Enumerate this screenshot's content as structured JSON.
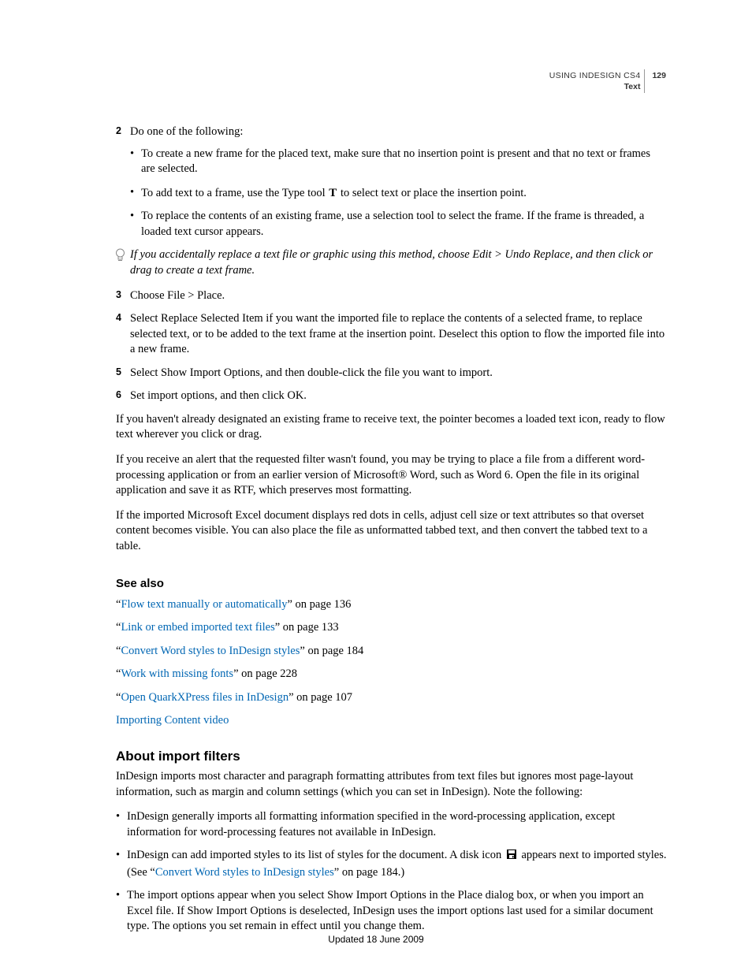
{
  "header": {
    "product": "USING INDESIGN CS4",
    "page_number": "129",
    "section": "Text"
  },
  "steps": {
    "s2": {
      "num": "2",
      "text": "Do one of the following:"
    },
    "s2_bullets": {
      "b1": "To create a new frame for the placed text, make sure that no insertion point is present and that no text or frames are selected.",
      "b2_a": "To add text to a frame, use the Type tool ",
      "b2_b": " to select text or place the insertion point.",
      "b3": "To replace the contents of an existing frame, use a selection tool to select the frame. If the frame is threaded, a loaded text cursor appears."
    },
    "tip": "If you accidentally replace a text file or graphic using this method, choose Edit > Undo Replace, and then click or drag to create a text frame.",
    "s3": {
      "num": "3",
      "text": "Choose File > Place."
    },
    "s4": {
      "num": "4",
      "text": "Select Replace Selected Item if you want the imported file to replace the contents of a selected frame, to replace selected text, or to be added to the text frame at the insertion point. Deselect this option to flow the imported file into a new frame."
    },
    "s5": {
      "num": "5",
      "text": "Select Show Import Options, and then double-click the file you want to import."
    },
    "s6": {
      "num": "6",
      "text": "Set import options, and then click OK."
    }
  },
  "paras": {
    "p1": "If you haven't already designated an existing frame to receive text, the pointer becomes a loaded text icon, ready to flow text wherever you click or drag.",
    "p2": "If you receive an alert that the requested filter wasn't found, you may be trying to place a file from a different word-processing application or from an earlier version of Microsoft® Word, such as Word 6. Open the file in its original application and save it as RTF, which preserves most formatting.",
    "p3": "If the imported Microsoft Excel document displays red dots in cells, adjust cell size or text attributes so that overset content becomes visible. You can also place the file as unformatted tabbed text, and then convert the tabbed text to a table."
  },
  "see_also": {
    "heading": "See also",
    "items": [
      {
        "link": "Flow text manually or automatically",
        "suffix": " on page 136"
      },
      {
        "link": "Link or embed imported text files",
        "suffix": " on page 133"
      },
      {
        "link": "Convert Word styles to InDesign styles",
        "suffix": " on page 184"
      },
      {
        "link": "Work with missing fonts",
        "suffix": " on page 228"
      },
      {
        "link": "Open QuarkXPress files in InDesign",
        "suffix": " on page 107"
      },
      {
        "link": "Importing Content video",
        "suffix": ""
      }
    ]
  },
  "filters": {
    "heading": "About import filters",
    "intro": "InDesign imports most character and paragraph formatting attributes from text files but ignores most page-layout information, such as margin and column settings (which you can set in InDesign). Note the following:",
    "b1": "InDesign generally imports all formatting information specified in the word-processing application, except information for word-processing features not available in InDesign.",
    "b2_a": "InDesign can add imported styles to its list of styles for the document. A disk icon ",
    "b2_b": " appears next to imported styles. (See “",
    "b2_link": "Convert Word styles to InDesign styles",
    "b2_c": "” on page 184.)",
    "b3": "The import options appear when you select Show Import Options in the Place dialog box, or when you import an Excel file. If Show Import Options is deselected, InDesign uses the import options last used for a similar document type. The options you set remain in effect until you change them."
  },
  "footer": "Updated 18 June 2009"
}
